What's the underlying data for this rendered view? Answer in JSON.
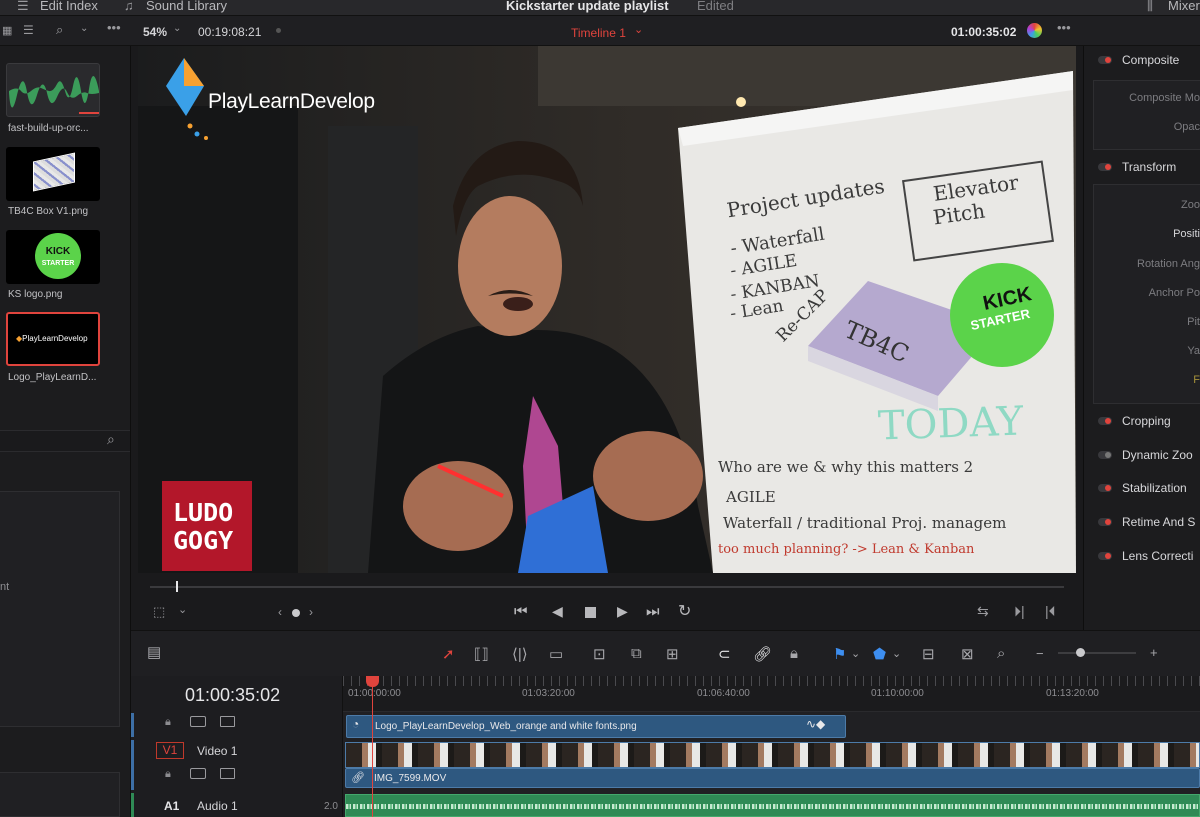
{
  "topbar": {
    "edit_index": "Edit Index",
    "sound_library": "Sound Library",
    "project_title": "Kickstarter update playlist",
    "edited": "Edited",
    "mixer": "Mixer"
  },
  "viewer_bar": {
    "zoom": "54%",
    "source_timecode": "00:19:08:21",
    "timeline_name": "Timeline 1",
    "record_timecode": "01:00:35:02"
  },
  "media_pool": {
    "items": [
      {
        "label": "fast-build-up-orc..."
      },
      {
        "label": "TB4C Box V1.png"
      },
      {
        "label": "KS logo.png"
      },
      {
        "label": "Logo_PlayLearnD..."
      }
    ],
    "partial_label": "nt"
  },
  "frame_content": {
    "logo_text": "PlayLearnDevelop",
    "ludo_line1": "LUDO",
    "ludo_line2": "GOGY",
    "board_lines": [
      "Project updates",
      "- Waterfall",
      "- AGILE",
      "- KANBAN",
      "- Lean",
      "Re-CAP",
      "Elevator",
      "Pitch",
      "TODAY",
      "Who are we & why this matters 2",
      "AGILE",
      "Waterfall / traditional Proj. managem",
      "too much planning? -> Lean & Kanban"
    ],
    "kick": "KICK",
    "starter": "STARTER",
    "tb4c": "TB4C"
  },
  "inspector": {
    "composite": "Composite",
    "composite_mode": "Composite Mo",
    "opacity": "Opac",
    "transform": "Transform",
    "zoom": "Zoo",
    "position": "Positi",
    "rotation": "Rotation Ang",
    "anchor": "Anchor Po",
    "pitch": "Pit",
    "yaw": "Ya",
    "flip": "F",
    "cropping": "Cropping",
    "dynamic_zoom": "Dynamic Zoo",
    "stabilization": "Stabilization",
    "retime": "Retime And S",
    "lens": "Lens Correcti"
  },
  "timeline": {
    "timecode": "01:00:35:02",
    "ruler": [
      "01:00:00:00",
      "01:03:20:00",
      "01:06:40:00",
      "01:10:00:00",
      "01:13:20:00"
    ],
    "track_v1_badge": "V1",
    "track_v1_name": "Video 1",
    "track_a1_badge": "A1",
    "track_a1_name": "Audio 1",
    "audio_level": "2.0",
    "clip_logo": "Logo_PlayLearnDevelop_Web_orange and white fonts.png",
    "clip_video": "IMG_7599.MOV"
  },
  "colors": {
    "accent_red": "#e0443d",
    "clip_blue": "#2e5880",
    "audio_green": "#2f8a55",
    "kick_green": "#5bd34a",
    "ludo_red": "#b3172a"
  }
}
